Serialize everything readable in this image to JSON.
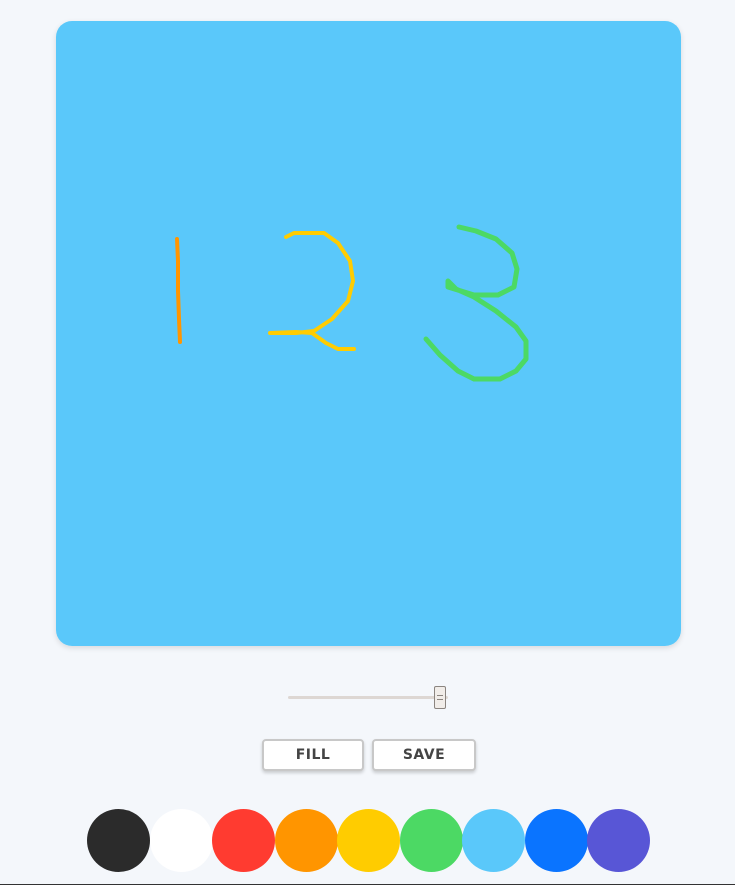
{
  "canvas": {
    "background_color": "#5ac8fa",
    "strokes": [
      {
        "name": "digit-1",
        "color": "#ff9500"
      },
      {
        "name": "digit-2",
        "color": "#ffcc00"
      },
      {
        "name": "digit-3",
        "color": "#4cd964"
      }
    ]
  },
  "brush_size_slider": {
    "value_fraction": 0.96
  },
  "buttons": {
    "fill_label": "FILL",
    "save_label": "SAVE"
  },
  "palette": {
    "colors": [
      {
        "name": "black",
        "hex": "#2b2b2b"
      },
      {
        "name": "white",
        "hex": "#ffffff"
      },
      {
        "name": "red",
        "hex": "#ff3b30"
      },
      {
        "name": "orange",
        "hex": "#ff9500"
      },
      {
        "name": "yellow",
        "hex": "#ffcc00"
      },
      {
        "name": "green",
        "hex": "#4cd964"
      },
      {
        "name": "light-blue",
        "hex": "#5ac8fa"
      },
      {
        "name": "blue",
        "hex": "#0a74ff"
      },
      {
        "name": "purple",
        "hex": "#5856d6"
      }
    ]
  }
}
